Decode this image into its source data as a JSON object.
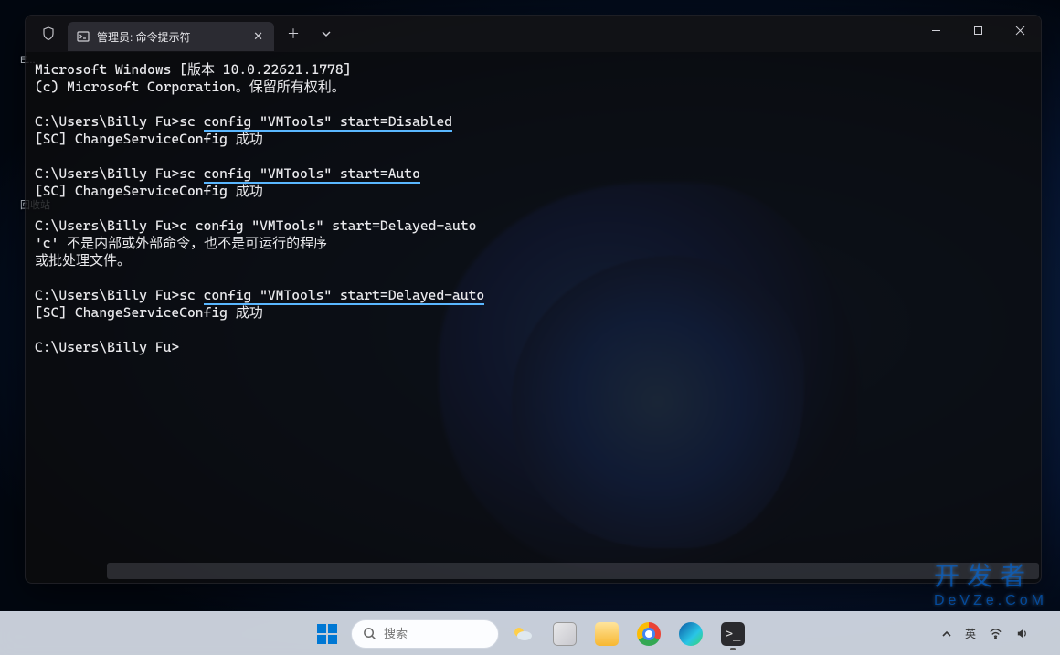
{
  "tab": {
    "title": "管理员: 命令提示符"
  },
  "terminal": {
    "l1": "Microsoft Windows [版本 10.0.22621.1778]",
    "l2": "(c) Microsoft Corporation。保留所有权利。",
    "p1_prompt": "C:\\Users\\Billy Fu>sc ",
    "p1_cmd": "config \"VMTools\" start=Disabled",
    "r1": "[SC] ChangeServiceConfig 成功",
    "p2_prompt": "C:\\Users\\Billy Fu>sc ",
    "p2_cmd": "config \"VMTools\" start=Auto",
    "r2": "[SC] ChangeServiceConfig 成功",
    "p3": "C:\\Users\\Billy Fu>c config \"VMTools\" start=Delayed-auto",
    "e1": "'c' 不是内部或外部命令，也不是可运行的程序",
    "e2": "或批处理文件。",
    "p4_prompt": "C:\\Users\\Billy Fu>sc ",
    "p4_cmd": "config \"VMTools\" start=Delayed-auto",
    "r4": "[SC] ChangeServiceConfig 成功",
    "p5": "C:\\Users\\Billy Fu>"
  },
  "taskbar": {
    "search_placeholder": "搜索"
  },
  "tray": {
    "lang": "英",
    "tip_up": "˄"
  },
  "watermark": {
    "line1": "开发者",
    "line2": "DeVZe.CoM"
  },
  "desktop": {
    "trash": "回收站",
    "this_pc": "此"
  }
}
